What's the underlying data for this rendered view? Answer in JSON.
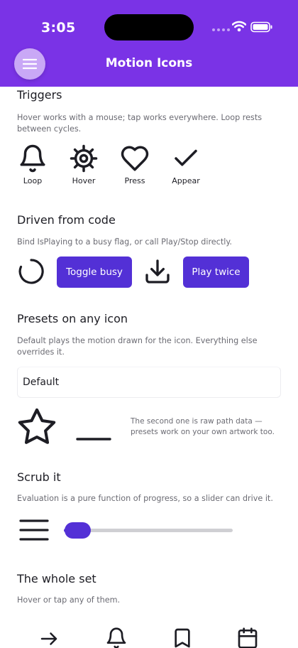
{
  "status_bar": {
    "time": "3:05"
  },
  "app": {
    "title": "Motion Icons",
    "menu_icon": "hamburger-icon"
  },
  "triggers": {
    "title": "Triggers",
    "description": "Hover works with a mouse; tap works everywhere. Loop rests between cycles.",
    "items": [
      {
        "icon": "bell-icon",
        "label": "Loop"
      },
      {
        "icon": "gear-icon",
        "label": "Hover"
      },
      {
        "icon": "heart-icon",
        "label": "Press"
      },
      {
        "icon": "check-icon",
        "label": "Appear"
      }
    ]
  },
  "driven": {
    "title": "Driven from code",
    "description": "Bind IsPlaying to a busy flag, or call Play/Stop directly.",
    "toggle_label": "Toggle busy",
    "play_label": "Play twice"
  },
  "presets": {
    "title": "Presets on any icon",
    "description": "Default plays the motion drawn for the icon. Everything else overrides it.",
    "selected": "Default",
    "note": "The second one is raw path data — presets work on your own artwork too."
  },
  "scrub": {
    "title": "Scrub it",
    "description": "Evaluation is a pure function of progress, so a slider can drive it.",
    "progress": 0.08
  },
  "whole_set": {
    "title": "The whole set",
    "description": "Hover or tap any of them.",
    "icons": [
      "arrow-right-icon",
      "bell-icon",
      "bookmark-icon",
      "calendar-icon"
    ]
  },
  "colors": {
    "header": "#7a33e6",
    "accent": "#5330d6",
    "menu_button": "#c9a8f6"
  }
}
